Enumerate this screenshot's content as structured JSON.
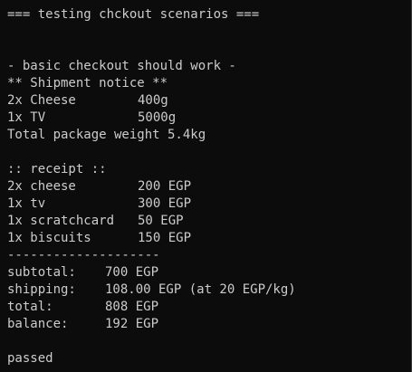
{
  "console": {
    "header": "=== testing chckout scenarios ===",
    "section_title": "- basic checkout should work -",
    "shipment": {
      "title": "** Shipment notice **",
      "items": [
        {
          "qty_name": "2x Cheese",
          "weight": "400g"
        },
        {
          "qty_name": "1x TV",
          "weight": "5000g"
        }
      ],
      "total": "Total package weight 5.4kg"
    },
    "receipt": {
      "title": ":: receipt ::",
      "items": [
        {
          "qty_name": "2x cheese",
          "price": "200 EGP"
        },
        {
          "qty_name": "1x tv",
          "price": "300 EGP"
        },
        {
          "qty_name": "1x scratchcard",
          "price": "50 EGP"
        },
        {
          "qty_name": "1x biscuits",
          "price": "150 EGP"
        }
      ],
      "divider": "--------------------",
      "summary": [
        {
          "label": "subtotal:",
          "value": "700 EGP"
        },
        {
          "label": "shipping:",
          "value": "108.00 EGP (at 20 EGP/kg)"
        },
        {
          "label": "total:",
          "value": "808 EGP"
        },
        {
          "label": "balance:",
          "value": "192 EGP"
        }
      ]
    },
    "result": "passed"
  }
}
